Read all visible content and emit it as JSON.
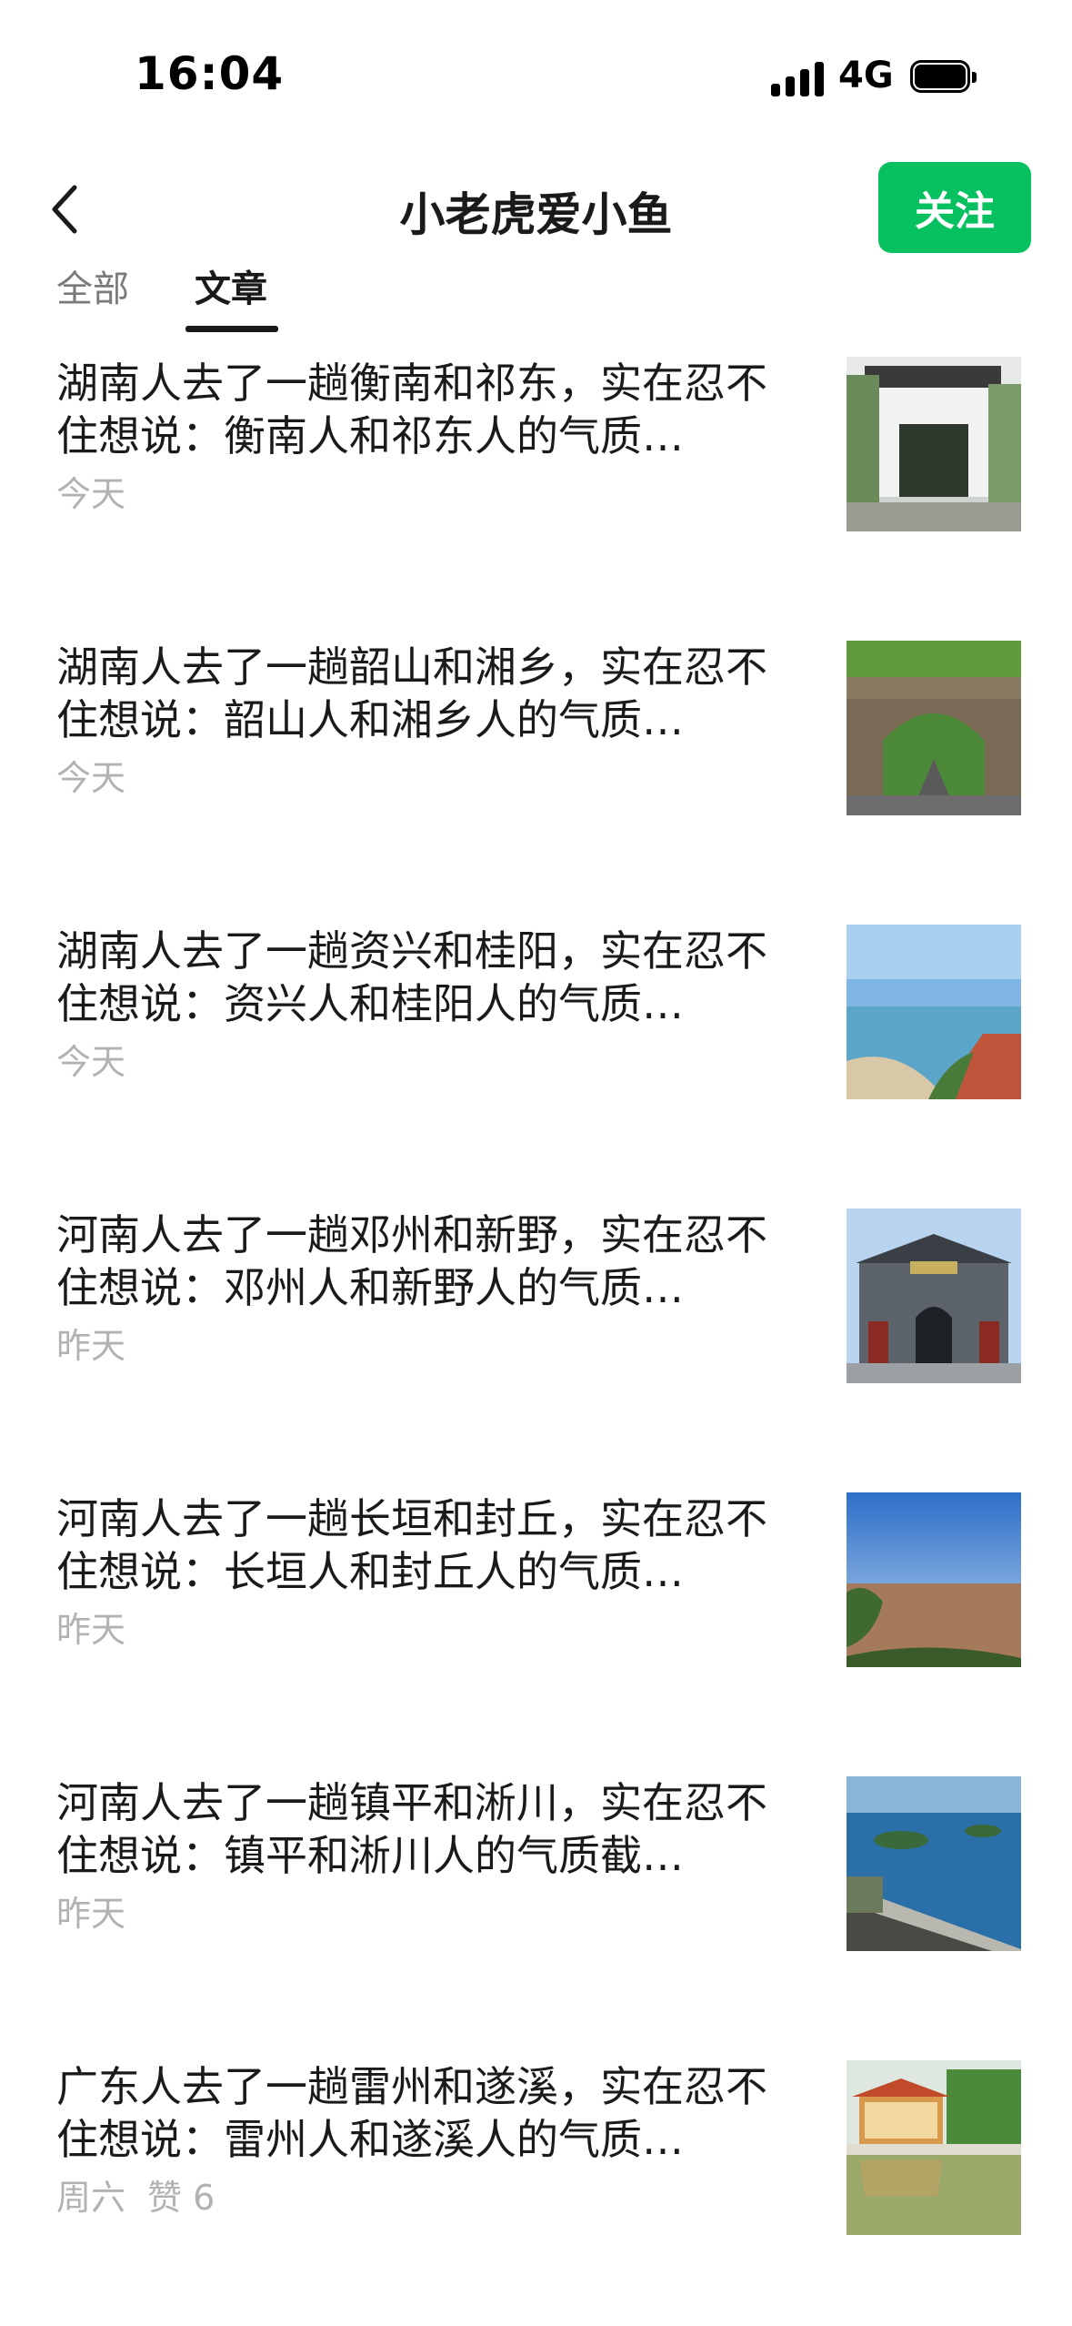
{
  "status_bar": {
    "time": "16:04",
    "network": "4G"
  },
  "header": {
    "title": "小老虎爱小鱼",
    "follow_label": "关注"
  },
  "tabs": [
    {
      "label": "全部"
    },
    {
      "label": "文章"
    }
  ],
  "articles": [
    {
      "title": "湖南人去了一趟衡南和祁东，实在忍不住想说：衡南人和祁东人的气质…",
      "date": "今天"
    },
    {
      "title": "湖南人去了一趟韶山和湘乡，实在忍不住想说：韶山人和湘乡人的气质…",
      "date": "今天"
    },
    {
      "title": "湖南人去了一趟资兴和桂阳，实在忍不住想说：资兴人和桂阳人的气质…",
      "date": "今天"
    },
    {
      "title": "河南人去了一趟邓州和新野，实在忍不住想说：邓州人和新野人的气质…",
      "date": "昨天"
    },
    {
      "title": "河南人去了一趟长垣和封丘，实在忍不住想说：长垣人和封丘人的气质…",
      "date": "昨天"
    },
    {
      "title": "河南人去了一趟镇平和淅川，实在忍不住想说：镇平和淅川人的气质截…",
      "date": "昨天"
    },
    {
      "title": "广东人去了一趟雷州和遂溪，实在忍不住想说：雷州人和遂溪人的气质…",
      "date": "周六",
      "likes": "赞 6"
    }
  ],
  "colors": {
    "accent": "#07c160",
    "meta_text": "#b2b2b2"
  }
}
